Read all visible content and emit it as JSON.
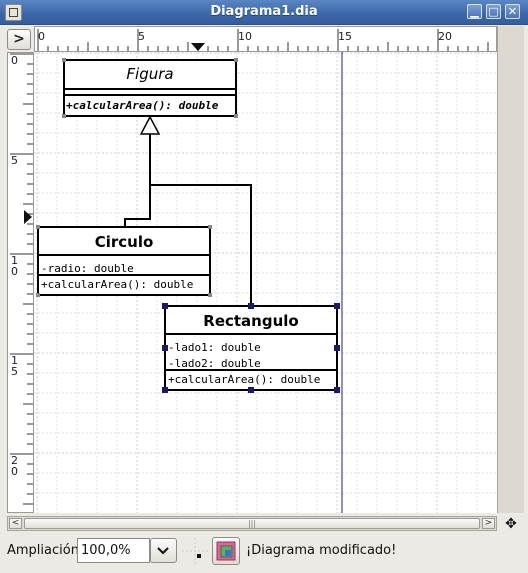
{
  "window": {
    "title": "Diagrama1.dia"
  },
  "hruler": {
    "labels": [
      "0",
      "5",
      "10",
      "15",
      "20"
    ]
  },
  "vruler": {
    "labels": [
      [
        "0"
      ],
      [
        "5"
      ],
      [
        "1",
        "0"
      ],
      [
        "1",
        "5"
      ],
      [
        "2",
        "0"
      ]
    ]
  },
  "classes": {
    "figura": {
      "name": "Figura",
      "operations": [
        "+calcularArea(): double"
      ]
    },
    "circulo": {
      "name": "Circulo",
      "attributes": [
        "-radio: double"
      ],
      "operations": [
        "+calcularArea(): double"
      ]
    },
    "rectangulo": {
      "name": "Rectangulo",
      "attributes": [
        "-lado1: double",
        "-lado2: double"
      ],
      "operations": [
        "+calcularArea(): double"
      ]
    }
  },
  "statusbar": {
    "zoom_label": "Ampliación",
    "zoom_value": "100,0%",
    "message": "¡Diagrama modificado!"
  },
  "icons": {
    "app": "dia-app-icon",
    "minimize": "minimize-icon",
    "maximize": "maximize-icon",
    "close": "close-icon",
    "move": "move-arrows-icon",
    "snap": "snap-to-grid-icon",
    "layers": "layers-icon"
  }
}
